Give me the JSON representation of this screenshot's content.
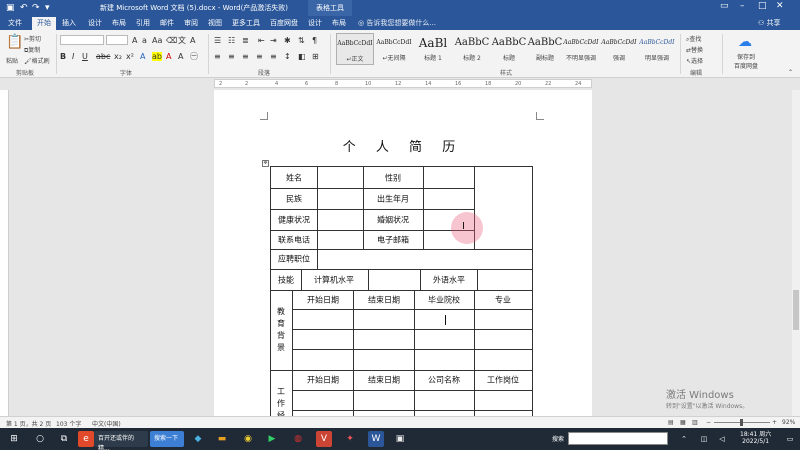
{
  "window": {
    "title": "新建 Microsoft Word 文档 (5).docx - Word(产品激活失败)",
    "context_tab": "表格工具"
  },
  "tabs": [
    "文件",
    "开始",
    "插入",
    "设计",
    "布局",
    "引用",
    "邮件",
    "审阅",
    "视图",
    "更多工具",
    "百度网盘",
    "设计",
    "布局"
  ],
  "tell_me": "告诉我您想要做什么...",
  "share": "共享",
  "ribbon": {
    "clipboard": {
      "paste": "粘贴",
      "cut": "剪切",
      "copy": "复制",
      "format_painter": "格式刷",
      "label": "剪贴板"
    },
    "font": {
      "name": "",
      "size": "",
      "label": "字体"
    },
    "paragraph": {
      "label": "段落"
    },
    "styles": {
      "label": "样式",
      "items": [
        {
          "preview": "AaBbCcDdI",
          "name": "↵正文"
        },
        {
          "preview": "AaBbCcDdI",
          "name": "↵无间隔"
        },
        {
          "preview": "AaBl",
          "name": "标题 1"
        },
        {
          "preview": "AaBbC",
          "name": "标题 2"
        },
        {
          "preview": "AaBbC",
          "name": "标题"
        },
        {
          "preview": "AaBbC",
          "name": "副标题"
        },
        {
          "preview": "AaBbCcDdI",
          "name": "不明显强调"
        },
        {
          "preview": "AaBbCcDdI",
          "name": "强调"
        },
        {
          "preview": "AaBbCcDdI",
          "name": "明显强调"
        }
      ]
    },
    "editing": {
      "find": "查找",
      "replace": "替换",
      "select": "选择",
      "label": "编辑"
    },
    "save": {
      "label": "保存到\n百度网盘"
    }
  },
  "document": {
    "title": "个 人 简 历",
    "rows": {
      "name": "姓名",
      "gender": "性别",
      "ethnicity": "民族",
      "birth": "出生年月",
      "health": "健康状况",
      "marital": "婚姻状况",
      "phone": "联系电话",
      "email": "电子邮箱",
      "position": "应聘职位",
      "skills": "技能",
      "computer": "计算机水平",
      "foreign": "外语水平"
    },
    "education": {
      "label": "教育背景",
      "cols": [
        "开始日期",
        "结束日期",
        "毕业院校",
        "专业"
      ]
    },
    "work": {
      "label": "工作经",
      "cols": [
        "开始日期",
        "结束日期",
        "公司名称",
        "工作岗位"
      ]
    }
  },
  "status": {
    "page": "第 1 页，共 2 页",
    "words": "103 个字",
    "lang": "中文(中国)",
    "zoom": "92%"
  },
  "watermark": {
    "line1": "激活 Windows",
    "line2": "转到\"设置\"以激活 Windows。"
  },
  "taskbar": {
    "app1": "百开还或伴的精...",
    "app2": "搜索一下",
    "search": "搜索",
    "time": "18:41 周六",
    "date": "2022/5/1"
  }
}
